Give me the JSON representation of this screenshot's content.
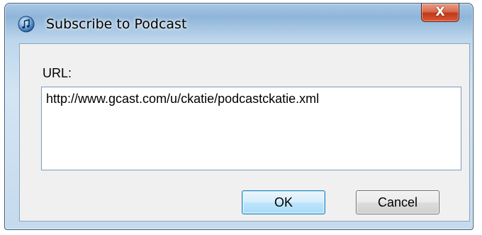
{
  "window": {
    "title": "Subscribe to Podcast",
    "app_icon": "itunes-icon",
    "close_icon": "close-icon",
    "close_glyph": "X",
    "accent_close": "#c1391b"
  },
  "form": {
    "url_label": "URL:",
    "url_value": "http://www.gcast.com/u/ckatie/podcastckatie.xml"
  },
  "buttons": {
    "ok_label": "OK",
    "cancel_label": "Cancel"
  }
}
